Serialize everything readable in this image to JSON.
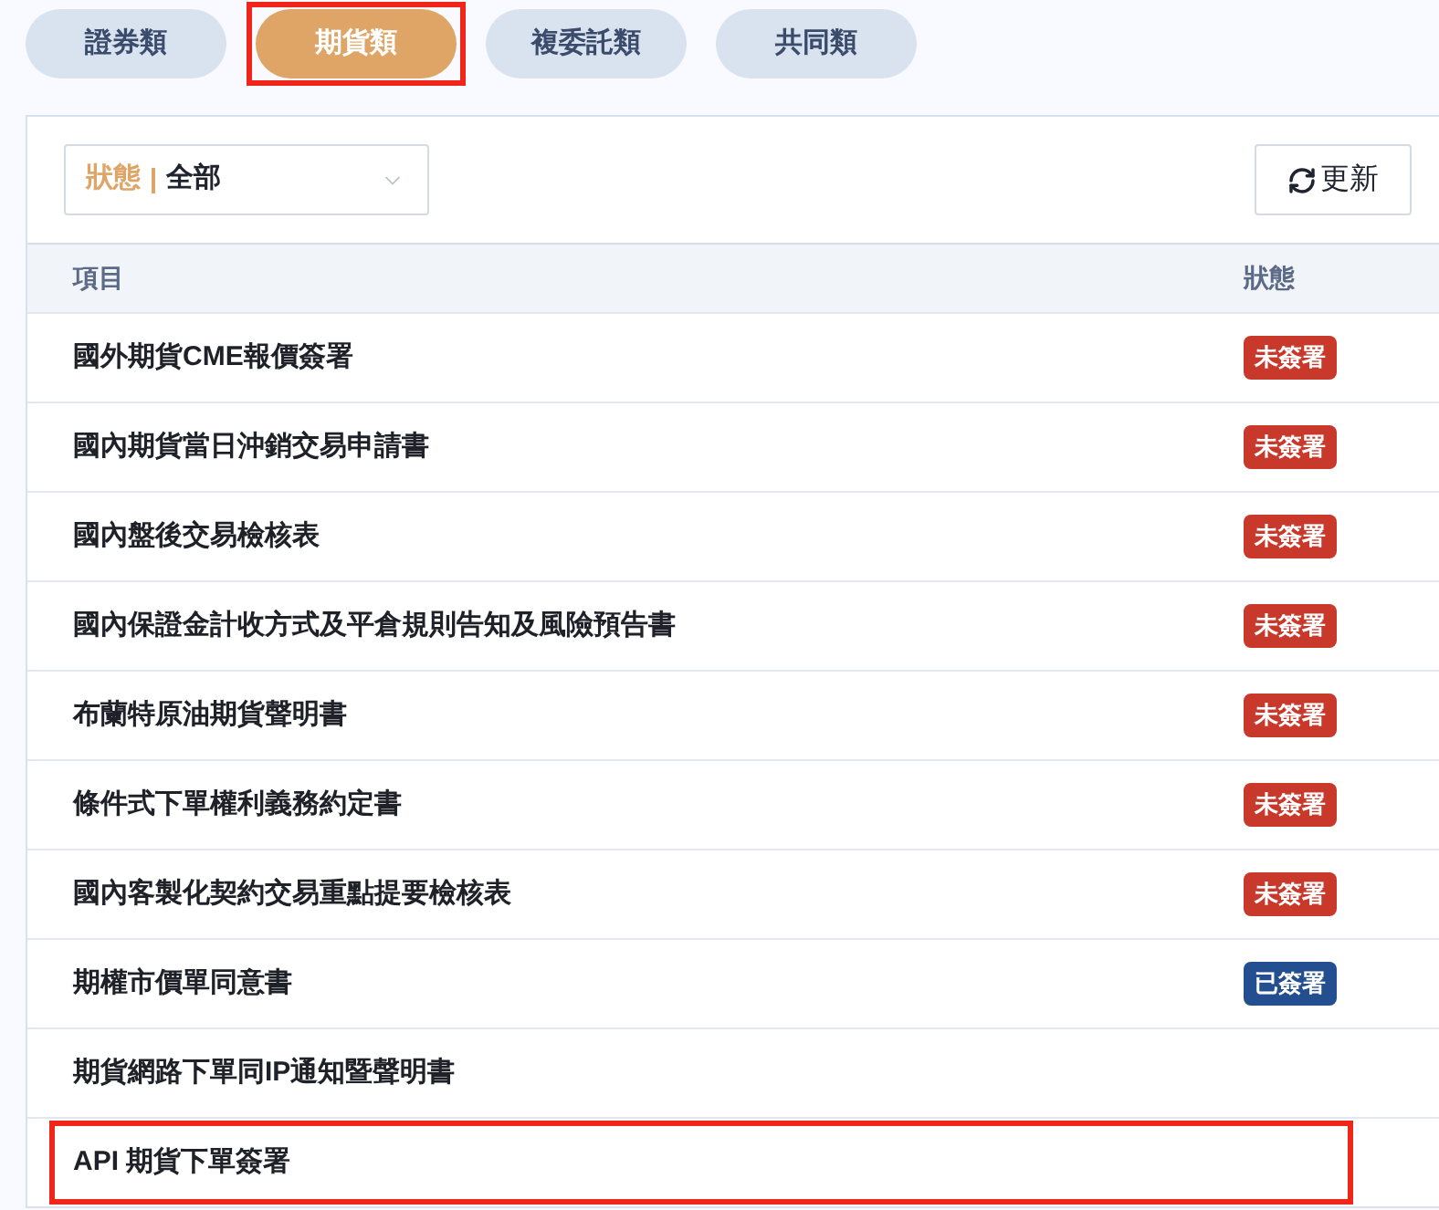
{
  "tabs": [
    {
      "label": "證券類",
      "selected": false,
      "highlighted": false
    },
    {
      "label": "期貨類",
      "selected": true,
      "highlighted": true
    },
    {
      "label": "複委託類",
      "selected": false,
      "highlighted": false
    },
    {
      "label": "共同類",
      "selected": false,
      "highlighted": false
    }
  ],
  "filter": {
    "label": "狀態",
    "value": "全部"
  },
  "refresh_button": {
    "label": "更新"
  },
  "table": {
    "columns": [
      "項目",
      "狀態"
    ],
    "rows": [
      {
        "item": "國外期貨CME報價簽署",
        "status": {
          "label": "未簽署",
          "color": "#c8392b"
        },
        "highlighted": false
      },
      {
        "item": "國內期貨當日沖銷交易申請書",
        "status": {
          "label": "未簽署",
          "color": "#c8392b"
        },
        "highlighted": false
      },
      {
        "item": "國內盤後交易檢核表",
        "status": {
          "label": "未簽署",
          "color": "#c8392b"
        },
        "highlighted": false
      },
      {
        "item": "國內保證金計收方式及平倉規則告知及風險預告書",
        "status": {
          "label": "未簽署",
          "color": "#c8392b"
        },
        "highlighted": false
      },
      {
        "item": "布蘭特原油期貨聲明書",
        "status": {
          "label": "未簽署",
          "color": "#c8392b"
        },
        "highlighted": false
      },
      {
        "item": "條件式下單權利義務約定書",
        "status": {
          "label": "未簽署",
          "color": "#c8392b"
        },
        "highlighted": false
      },
      {
        "item": "國內客製化契約交易重點提要檢核表",
        "status": {
          "label": "未簽署",
          "color": "#c8392b"
        },
        "highlighted": false
      },
      {
        "item": "期權市價單同意書",
        "status": {
          "label": "已簽署",
          "color": "#234e8f"
        },
        "highlighted": false
      },
      {
        "item": "期貨網路下單同IP通知暨聲明書",
        "highlighted": false
      },
      {
        "item": "API 期貨下單簽署",
        "highlighted": true
      }
    ]
  }
}
